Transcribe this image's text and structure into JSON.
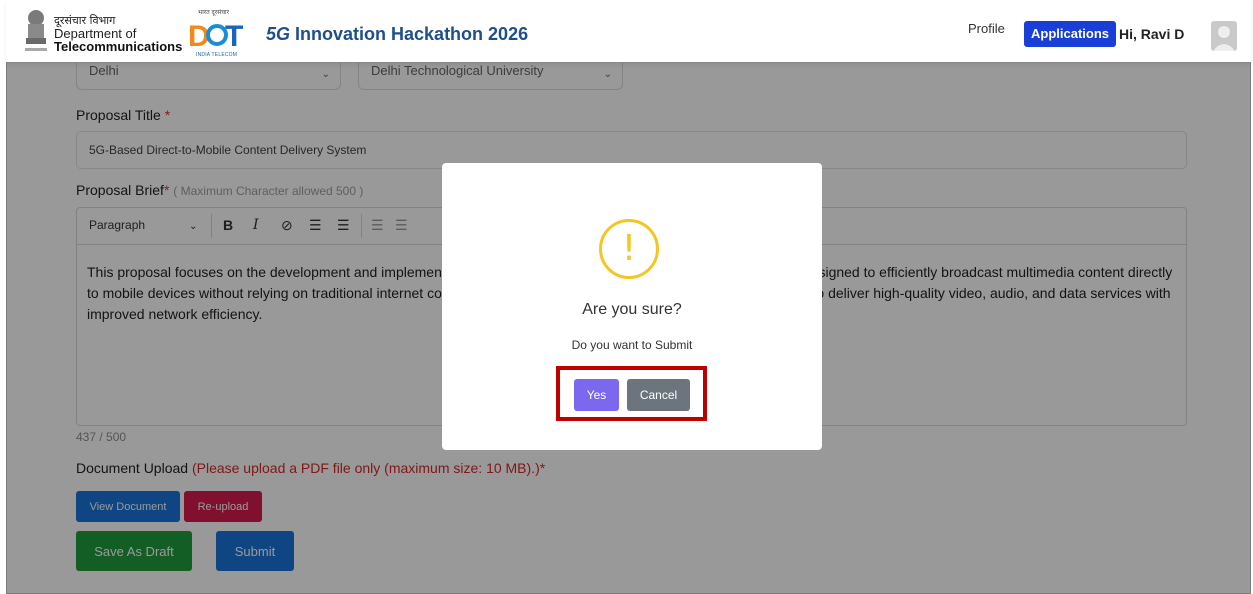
{
  "header": {
    "dept_hindi": "दूरसंचार विभाग",
    "dept_line1": "Department of",
    "dept_line2": "Telecommunications",
    "dot_hindi": "भारत दूरसंचार",
    "dot_text": "DOT",
    "dot_sub": "INDIA TELECOM",
    "hackathon_5g": "5G",
    "hackathon_title": "Innovation Hackathon 2026",
    "nav_profile": "Profile",
    "nav_applications": "Applications",
    "greeting": "Hi, Ravi D"
  },
  "form": {
    "state_value": "Delhi",
    "university_value": "Delhi Technological University",
    "proposal_title_label": "Proposal Title",
    "proposal_title_value": "5G-Based Direct-to-Mobile Content Delivery System",
    "proposal_brief_label": "Proposal Brief",
    "proposal_brief_hint": "( Maximum Character allowed 500 )",
    "toolbar_paragraph": "Paragraph",
    "brief_text": "This proposal focuses on the development and implementation of a Direct-to-Mobile (D2M) content delivery system designed to efficiently broadcast multimedia content directly to mobile devices without relying on traditional internet connectivity. The solution leverages 5G broadcast capabilities to deliver high-quality video, audio, and data services with improved network efficiency.",
    "char_count": "437 / 500",
    "doc_upload_label": "Document Upload",
    "doc_upload_note": "(Please upload a PDF file only (maximum size: 10 MB).)",
    "required_marker": "*",
    "view_document": "View Document",
    "reupload": "Re-upload",
    "save_draft": "Save As Draft",
    "submit": "Submit"
  },
  "modal": {
    "icon_symbol": "!",
    "title": "Are you sure?",
    "text": "Do you want to Submit",
    "yes": "Yes",
    "cancel": "Cancel"
  },
  "colors": {
    "primary": "#1a73d9",
    "applications_nav": "#1a3fd6",
    "confirm_button": "#7b68ee",
    "cancel_button": "#6c757d",
    "danger": "#d81b4f",
    "success": "#1f9d3f",
    "warning": "#f3c623",
    "highlight_box": "#c00000"
  },
  "icons": [
    "emblem-icon",
    "dot-logo-icon",
    "chevron-down-icon",
    "bold-icon",
    "italic-icon",
    "link-icon",
    "bullet-list-icon",
    "numbered-list-icon",
    "outdent-icon",
    "indent-icon",
    "warning-icon",
    "avatar-icon"
  ]
}
